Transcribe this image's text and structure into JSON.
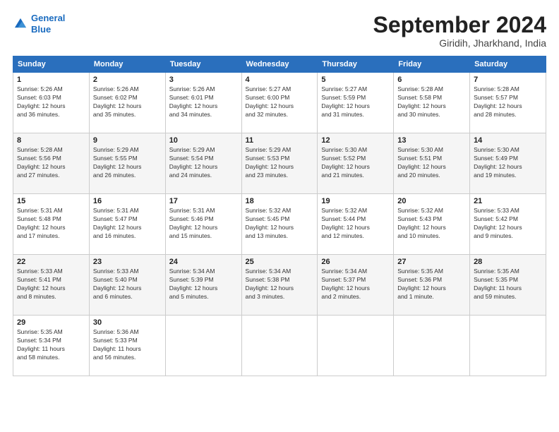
{
  "logo": {
    "line1": "General",
    "line2": "Blue"
  },
  "title": "September 2024",
  "location": "Giridih, Jharkhand, India",
  "days_header": [
    "Sunday",
    "Monday",
    "Tuesday",
    "Wednesday",
    "Thursday",
    "Friday",
    "Saturday"
  ],
  "weeks": [
    [
      {
        "day": "1",
        "info": "Sunrise: 5:26 AM\nSunset: 6:03 PM\nDaylight: 12 hours\nand 36 minutes."
      },
      {
        "day": "2",
        "info": "Sunrise: 5:26 AM\nSunset: 6:02 PM\nDaylight: 12 hours\nand 35 minutes."
      },
      {
        "day": "3",
        "info": "Sunrise: 5:26 AM\nSunset: 6:01 PM\nDaylight: 12 hours\nand 34 minutes."
      },
      {
        "day": "4",
        "info": "Sunrise: 5:27 AM\nSunset: 6:00 PM\nDaylight: 12 hours\nand 32 minutes."
      },
      {
        "day": "5",
        "info": "Sunrise: 5:27 AM\nSunset: 5:59 PM\nDaylight: 12 hours\nand 31 minutes."
      },
      {
        "day": "6",
        "info": "Sunrise: 5:28 AM\nSunset: 5:58 PM\nDaylight: 12 hours\nand 30 minutes."
      },
      {
        "day": "7",
        "info": "Sunrise: 5:28 AM\nSunset: 5:57 PM\nDaylight: 12 hours\nand 28 minutes."
      }
    ],
    [
      {
        "day": "8",
        "info": "Sunrise: 5:28 AM\nSunset: 5:56 PM\nDaylight: 12 hours\nand 27 minutes."
      },
      {
        "day": "9",
        "info": "Sunrise: 5:29 AM\nSunset: 5:55 PM\nDaylight: 12 hours\nand 26 minutes."
      },
      {
        "day": "10",
        "info": "Sunrise: 5:29 AM\nSunset: 5:54 PM\nDaylight: 12 hours\nand 24 minutes."
      },
      {
        "day": "11",
        "info": "Sunrise: 5:29 AM\nSunset: 5:53 PM\nDaylight: 12 hours\nand 23 minutes."
      },
      {
        "day": "12",
        "info": "Sunrise: 5:30 AM\nSunset: 5:52 PM\nDaylight: 12 hours\nand 21 minutes."
      },
      {
        "day": "13",
        "info": "Sunrise: 5:30 AM\nSunset: 5:51 PM\nDaylight: 12 hours\nand 20 minutes."
      },
      {
        "day": "14",
        "info": "Sunrise: 5:30 AM\nSunset: 5:49 PM\nDaylight: 12 hours\nand 19 minutes."
      }
    ],
    [
      {
        "day": "15",
        "info": "Sunrise: 5:31 AM\nSunset: 5:48 PM\nDaylight: 12 hours\nand 17 minutes."
      },
      {
        "day": "16",
        "info": "Sunrise: 5:31 AM\nSunset: 5:47 PM\nDaylight: 12 hours\nand 16 minutes."
      },
      {
        "day": "17",
        "info": "Sunrise: 5:31 AM\nSunset: 5:46 PM\nDaylight: 12 hours\nand 15 minutes."
      },
      {
        "day": "18",
        "info": "Sunrise: 5:32 AM\nSunset: 5:45 PM\nDaylight: 12 hours\nand 13 minutes."
      },
      {
        "day": "19",
        "info": "Sunrise: 5:32 AM\nSunset: 5:44 PM\nDaylight: 12 hours\nand 12 minutes."
      },
      {
        "day": "20",
        "info": "Sunrise: 5:32 AM\nSunset: 5:43 PM\nDaylight: 12 hours\nand 10 minutes."
      },
      {
        "day": "21",
        "info": "Sunrise: 5:33 AM\nSunset: 5:42 PM\nDaylight: 12 hours\nand 9 minutes."
      }
    ],
    [
      {
        "day": "22",
        "info": "Sunrise: 5:33 AM\nSunset: 5:41 PM\nDaylight: 12 hours\nand 8 minutes."
      },
      {
        "day": "23",
        "info": "Sunrise: 5:33 AM\nSunset: 5:40 PM\nDaylight: 12 hours\nand 6 minutes."
      },
      {
        "day": "24",
        "info": "Sunrise: 5:34 AM\nSunset: 5:39 PM\nDaylight: 12 hours\nand 5 minutes."
      },
      {
        "day": "25",
        "info": "Sunrise: 5:34 AM\nSunset: 5:38 PM\nDaylight: 12 hours\nand 3 minutes."
      },
      {
        "day": "26",
        "info": "Sunrise: 5:34 AM\nSunset: 5:37 PM\nDaylight: 12 hours\nand 2 minutes."
      },
      {
        "day": "27",
        "info": "Sunrise: 5:35 AM\nSunset: 5:36 PM\nDaylight: 12 hours\nand 1 minute."
      },
      {
        "day": "28",
        "info": "Sunrise: 5:35 AM\nSunset: 5:35 PM\nDaylight: 11 hours\nand 59 minutes."
      }
    ],
    [
      {
        "day": "29",
        "info": "Sunrise: 5:35 AM\nSunset: 5:34 PM\nDaylight: 11 hours\nand 58 minutes."
      },
      {
        "day": "30",
        "info": "Sunrise: 5:36 AM\nSunset: 5:33 PM\nDaylight: 11 hours\nand 56 minutes."
      },
      {
        "day": "",
        "info": ""
      },
      {
        "day": "",
        "info": ""
      },
      {
        "day": "",
        "info": ""
      },
      {
        "day": "",
        "info": ""
      },
      {
        "day": "",
        "info": ""
      }
    ]
  ]
}
